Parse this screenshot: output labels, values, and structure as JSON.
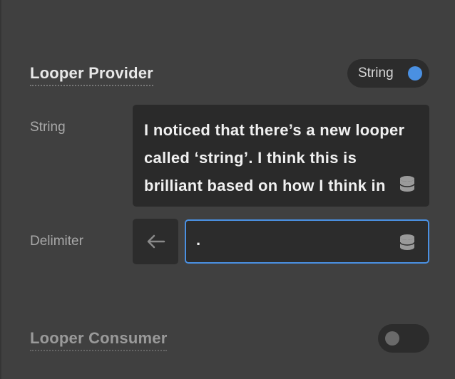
{
  "looper_provider": {
    "title": "Looper Provider",
    "toggle_label": "String",
    "toggle_on": true
  },
  "string_field": {
    "label": "String",
    "value": "I noticed that there’s a new looper called ‘string’. I think this is brilliant based on how I think in codes. But if"
  },
  "delimiter_field": {
    "label": "Delimiter",
    "value": "."
  },
  "looper_consumer": {
    "title": "Looper Consumer",
    "toggle_on": false
  },
  "colors": {
    "accent": "#4a90e2",
    "background": "#404040",
    "field": "#2c2c2c"
  },
  "icons": [
    "database-icon",
    "arrow-left-icon"
  ]
}
